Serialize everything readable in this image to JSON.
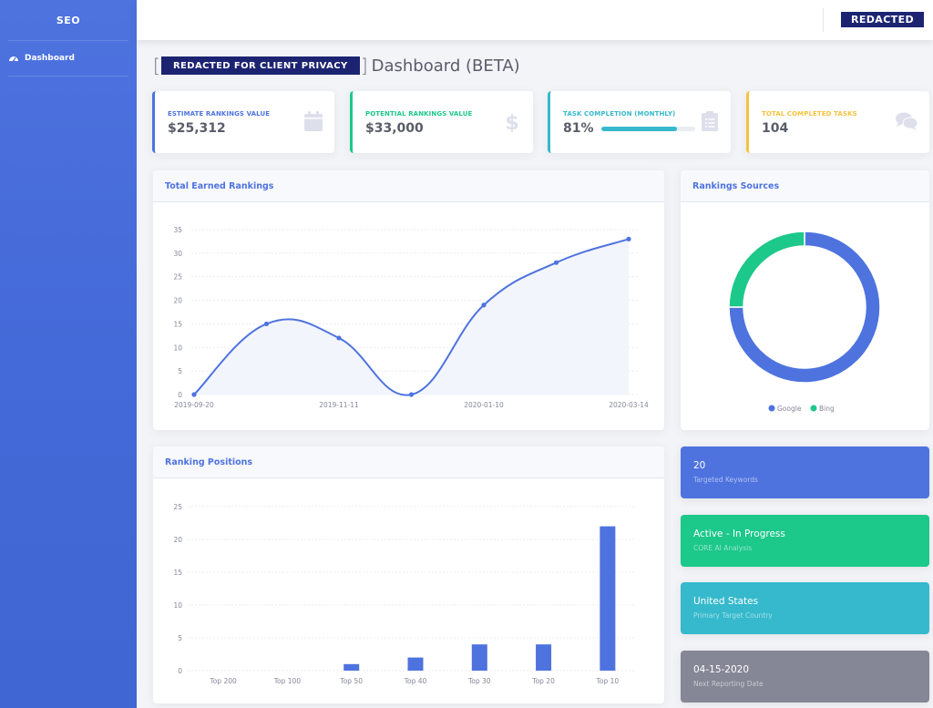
{
  "sidebar": {
    "brand": "SEO",
    "items": [
      {
        "label": "Dashboard",
        "icon": "tachometer-icon"
      }
    ]
  },
  "topbar": {
    "user_label": "REDACTED"
  },
  "heading": {
    "redacted_label": "REDACTED FOR CLIENT PRIVACY",
    "bracket_open": "[",
    "bracket_close": "]",
    "title": "Dashboard (BETA)"
  },
  "stats": [
    {
      "label": "Estimate Rankings Value",
      "value": "$25,312",
      "icon": "calendar-icon",
      "color": "#4e73df"
    },
    {
      "label": "Potential Rankings Value",
      "value": "$33,000",
      "icon": "dollar-icon",
      "color": "#1cc88a"
    },
    {
      "label": "Task Completion (Monthly)",
      "value": "81%",
      "progress": 0.81,
      "icon": "clipboard-list-icon",
      "color": "#36b9cc"
    },
    {
      "label": "Total Completed Tasks",
      "value": "104",
      "icon": "comments-icon",
      "color": "#f6c23e"
    }
  ],
  "panels": {
    "earned_title": "Total Earned Rankings",
    "sources_title": "Rankings Sources",
    "positions_title": "Ranking Positions"
  },
  "info_cards": [
    {
      "big": "20",
      "small": "Targeted Keywords",
      "color": "#4e73df"
    },
    {
      "big": "Active - In Progress",
      "small": "CORE AI Analysis",
      "color": "#1cc88a"
    },
    {
      "big": "United States",
      "small": "Primary Target Country",
      "color": "#36b9cc"
    },
    {
      "big": "04-15-2020",
      "small": "Next Reporting Date",
      "color": "#858796"
    }
  ],
  "chart_data": [
    {
      "type": "area",
      "title": "Total Earned Rankings",
      "x_labels_shown": [
        "2019-09-20",
        "2019-11-11",
        "2020-01-10",
        "2020-03-14"
      ],
      "x_label_every": 2,
      "values": [
        0,
        15,
        12,
        0,
        19,
        28,
        33
      ],
      "yticks": [
        0,
        5,
        10,
        15,
        20,
        25,
        30,
        35
      ],
      "ylim": [
        0,
        35
      ],
      "grid": true,
      "line_color": "#4e73df",
      "fill_color": "#f3f5fc"
    },
    {
      "type": "pie",
      "title": "Rankings Sources",
      "donut": true,
      "labels": [
        "Google",
        "Bing"
      ],
      "values": [
        75,
        25
      ],
      "colors": [
        "#4e73df",
        "#1cc88a"
      ],
      "legend": "bottom"
    },
    {
      "type": "bar",
      "title": "Ranking Positions",
      "categories": [
        "Top 200",
        "Top 100",
        "Top 50",
        "Top 40",
        "Top 30",
        "Top 20",
        "Top 10"
      ],
      "values": [
        0,
        0,
        1,
        2,
        4,
        4,
        22
      ],
      "yticks": [
        0,
        5,
        10,
        15,
        20,
        25
      ],
      "ylim": [
        0,
        25
      ],
      "grid": true,
      "bar_color": "#4e73df"
    }
  ]
}
